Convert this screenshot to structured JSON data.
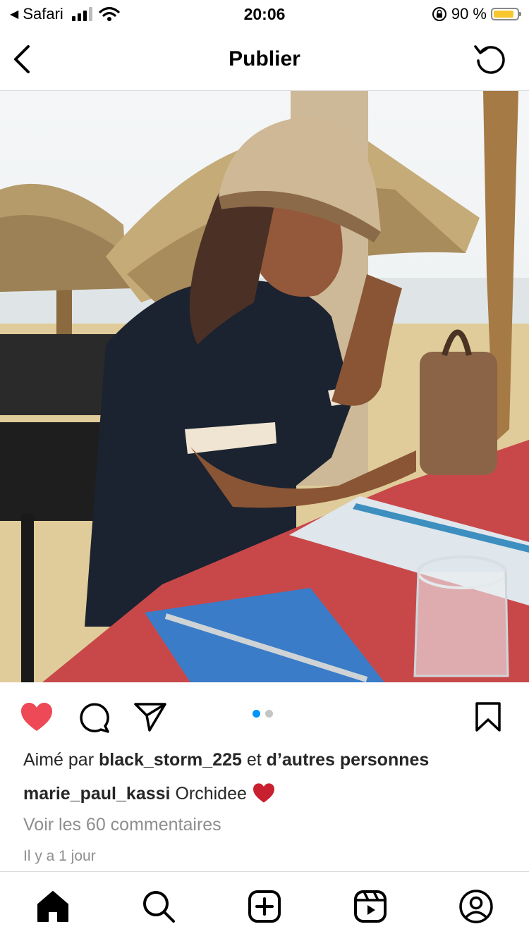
{
  "status_bar": {
    "back_app": "Safari",
    "time": "20:06",
    "battery": "90 %"
  },
  "header": {
    "title": "Publier"
  },
  "post": {
    "photo_description_colors": {
      "tablecloth": "#c8484a",
      "shirt": "#1b2230",
      "sand": "#e0cc9a"
    },
    "liked": true,
    "carousel_count": 2,
    "carousel_active_index": 0,
    "likes_prefix": "Aimé par",
    "liked_by_user": "black_storm_225",
    "likes_connector": "et",
    "likes_others": "d’autres personnes",
    "author": "marie_paul_kassi",
    "caption_text": "Orchidee",
    "caption_emoji": "❤️",
    "comments_link": "Voir les 60 commentaires",
    "time_ago": "Il y a 1 jour"
  },
  "icons": {
    "heart": "heart-icon",
    "comment": "comment-icon",
    "share": "paper-plane-icon",
    "save": "bookmark-icon"
  },
  "colors": {
    "like_red": "#ed4956",
    "accent_blue": "#0095f6",
    "muted": "#8e8e8e"
  }
}
